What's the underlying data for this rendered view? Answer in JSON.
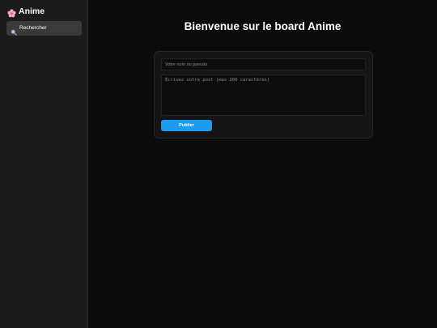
{
  "sidebar": {
    "logo": {
      "icon": "cherry-blossom-icon",
      "text": "Anime"
    },
    "search": {
      "icon": "search-icon",
      "label": "Rechercher"
    }
  },
  "main": {
    "title": "Bienvenue sur le board Anime",
    "form": {
      "name_placeholder": "Votre nom ou pseudo",
      "name_value": "",
      "post_placeholder": "Écrivez votre post (max 200 caractères)",
      "post_value": "",
      "submit_label": "Publier"
    }
  },
  "colors": {
    "background": "#0b0b0b",
    "sidebar": "#1b1b1b",
    "card": "#141414",
    "accent": "#1d9bf0",
    "logo_icon": "#f4a7c8"
  }
}
